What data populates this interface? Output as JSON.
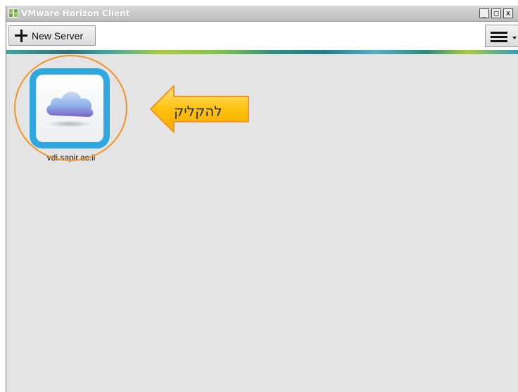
{
  "window": {
    "title": "VMware Horizon Client",
    "controls": {
      "minimize": "_",
      "maximize": "□",
      "close": "x"
    }
  },
  "toolbar": {
    "new_server_label": "New Server",
    "new_server_icon": "plus-icon",
    "menu_icon": "hamburger-icon"
  },
  "servers": [
    {
      "label": "vdi.sapir.ac.il",
      "icon": "cloud-icon"
    }
  ],
  "annotation": {
    "text": "להקליק",
    "arrow_color": "#ffc20e",
    "ring_color": "#f39425"
  },
  "colors": {
    "tile_border": "#2fa8e0",
    "content_bg": "#e4e4e4"
  }
}
